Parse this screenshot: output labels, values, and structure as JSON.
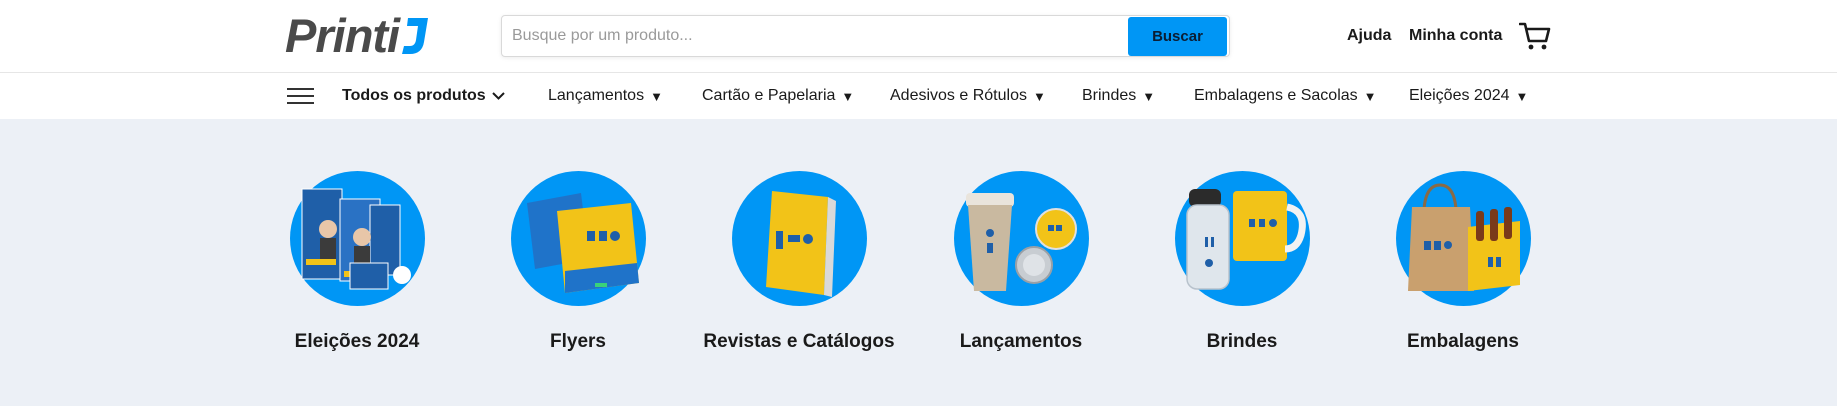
{
  "brand": {
    "name": "Printi"
  },
  "search": {
    "placeholder": "Busque por um produto...",
    "button_label": "Buscar"
  },
  "header_links": {
    "help": "Ajuda",
    "account": "Minha conta"
  },
  "nav": {
    "all_products": "Todos os produtos",
    "items": [
      {
        "label": "Lançamentos",
        "caret": "▼"
      },
      {
        "label": "Cartão e Papelaria",
        "caret": "▼"
      },
      {
        "label": "Adesivos e Rótulos",
        "caret": "▼"
      },
      {
        "label": "Brindes",
        "caret": "▼"
      },
      {
        "label": "Embalagens e Sacolas",
        "caret": "▼"
      },
      {
        "label": "Eleições 2024",
        "caret": "▼"
      }
    ]
  },
  "categories": [
    {
      "label": "Eleições 2024",
      "icon": "election-materials-icon"
    },
    {
      "label": "Flyers",
      "icon": "flyers-icon"
    },
    {
      "label": "Revistas e Catálogos",
      "icon": "magazine-icon"
    },
    {
      "label": "Lançamentos",
      "icon": "cup-and-buttons-icon"
    },
    {
      "label": "Brindes",
      "icon": "mug-and-bottle-icon"
    },
    {
      "label": "Embalagens",
      "icon": "bags-icon"
    }
  ],
  "colors": {
    "accent": "#0096f5",
    "brand_yellow": "#f2c318",
    "background": "#ecf0f6"
  }
}
